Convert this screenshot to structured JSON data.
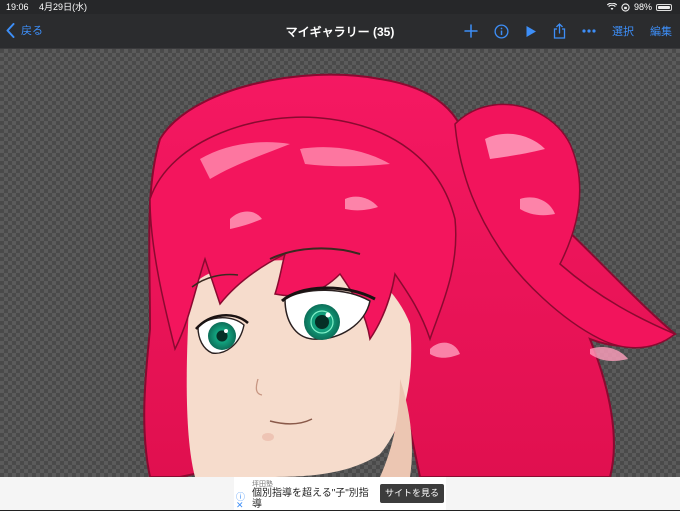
{
  "status_bar": {
    "time": "19:06",
    "date": "4月29日(水)",
    "battery": "98%",
    "battery_level": 0.98,
    "icons": [
      "wifi-icon",
      "orientation-lock-icon",
      "battery-icon"
    ]
  },
  "nav": {
    "back_label": "戻る",
    "title": "マイギャラリー (35)",
    "select_label": "選択",
    "edit_label": "編集",
    "icons": [
      "add-icon",
      "info-icon",
      "play-icon",
      "share-icon",
      "more-icon"
    ],
    "accent_color": "#3d8ef7"
  },
  "canvas": {
    "image_subject": "anime-girl-red-hair-green-eyes",
    "hair_color": "#f0165c",
    "eye_color": "#18a882",
    "skin_color": "#f6dccc"
  },
  "ad": {
    "sponsor": "坪田塾",
    "headline": "個別指導を超える\"子\"別指導",
    "cta": "サイトを見る",
    "icons": [
      "ad-info-icon",
      "ad-close-icon"
    ]
  }
}
